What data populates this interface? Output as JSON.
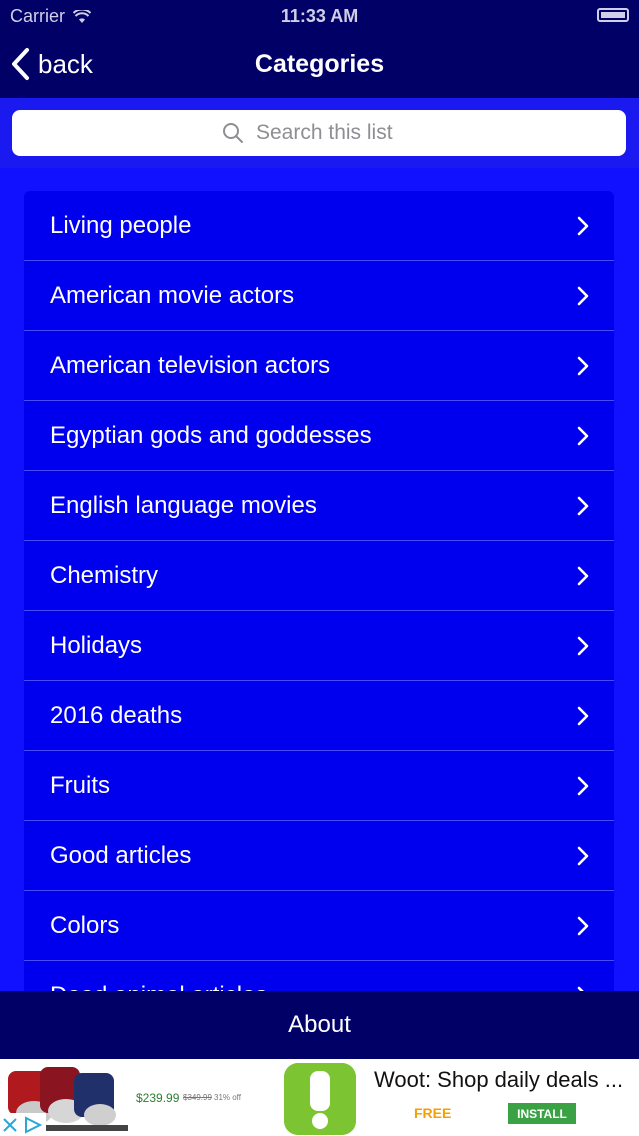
{
  "status_bar": {
    "carrier": "Carrier",
    "time": "11:33 AM"
  },
  "nav": {
    "back_label": "back",
    "title": "Categories"
  },
  "search": {
    "placeholder": "Search this list"
  },
  "categories": [
    "Living people",
    "American movie actors",
    "American television actors",
    "Egyptian gods and goddesses",
    "English language movies",
    "Chemistry",
    "Holidays",
    "2016 deaths",
    "Fruits",
    "Good articles",
    "Colors",
    "Dead animal articles"
  ],
  "footer": {
    "about_label": "About"
  },
  "ad": {
    "price": "$239.99",
    "old_price": "$349.99",
    "discount": "31% off",
    "title": "Woot: Shop daily deals ...",
    "free_label": "FREE",
    "install_label": "INSTALL"
  },
  "colors": {
    "nav_bg": "#000066",
    "list_bg": "#0000ee",
    "page_bg": "#1111ff",
    "install_green": "#3aa245",
    "free_orange": "#f5a000"
  }
}
